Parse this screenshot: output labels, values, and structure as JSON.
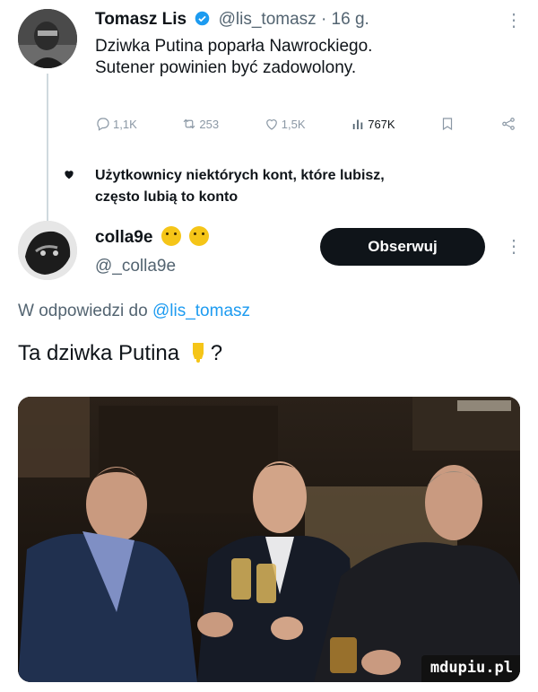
{
  "tweet1": {
    "author_name": "Tomasz Lis",
    "handle_time": "@lis_tomasz · 16 g.",
    "more_icon": "⋮",
    "lines": [
      "Dziwka Putina poparła Nawrockiego.",
      "Sutener powinien być zadowolony."
    ],
    "replies": "1,1K",
    "reposts": "253",
    "likes": "1,5K",
    "views": "767K"
  },
  "notice": {
    "line1": "Użytkownicy niektórych kont, które lubisz,",
    "line2": "często lubią to konto"
  },
  "tweet2": {
    "author_name": "colla9e",
    "handle": "@_colla9e",
    "follow_label": "Obserwuj",
    "reply_prefix": "W odpowiedzi do ",
    "reply_handle": "@lis_tomasz",
    "text": "Ta dziwka Putina",
    "text_suffix": "?"
  },
  "photo": {
    "watermark": "mdupiu.pl"
  },
  "colors": {
    "accent": "#1d9bf0",
    "text": "#0f1419",
    "muted": "#536471",
    "button_bg": "#0f1419"
  }
}
